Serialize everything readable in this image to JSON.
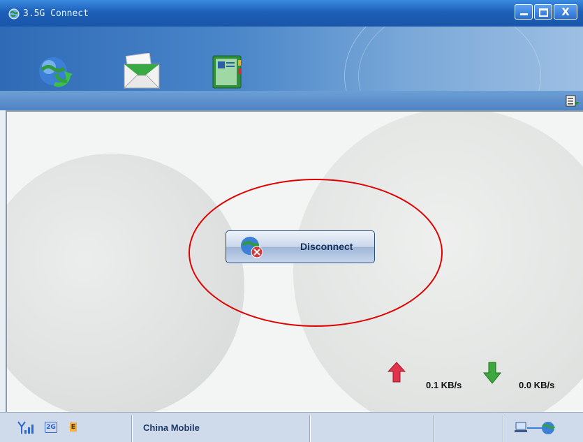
{
  "window": {
    "title": "3.5G Connect",
    "controls": {
      "minimize": "minimize",
      "maximize": "maximize",
      "close": "X"
    }
  },
  "toolbar": {
    "items": [
      {
        "name": "connect",
        "icon": "globe-refresh-icon"
      },
      {
        "name": "sms",
        "icon": "envelope-icon"
      },
      {
        "name": "phonebook",
        "icon": "phonebook-icon"
      }
    ]
  },
  "main": {
    "button_label": "Disconnect",
    "upload_speed": "0.1 KB/s",
    "download_speed": "0.0 KB/s"
  },
  "status": {
    "network_type": "2G",
    "edge": "E",
    "operator": "China Mobile"
  },
  "colors": {
    "titlebar": "#1d5fb8",
    "annotation": "#e00000",
    "upload_arrow": "#e0344a",
    "download_arrow": "#3da83d"
  }
}
